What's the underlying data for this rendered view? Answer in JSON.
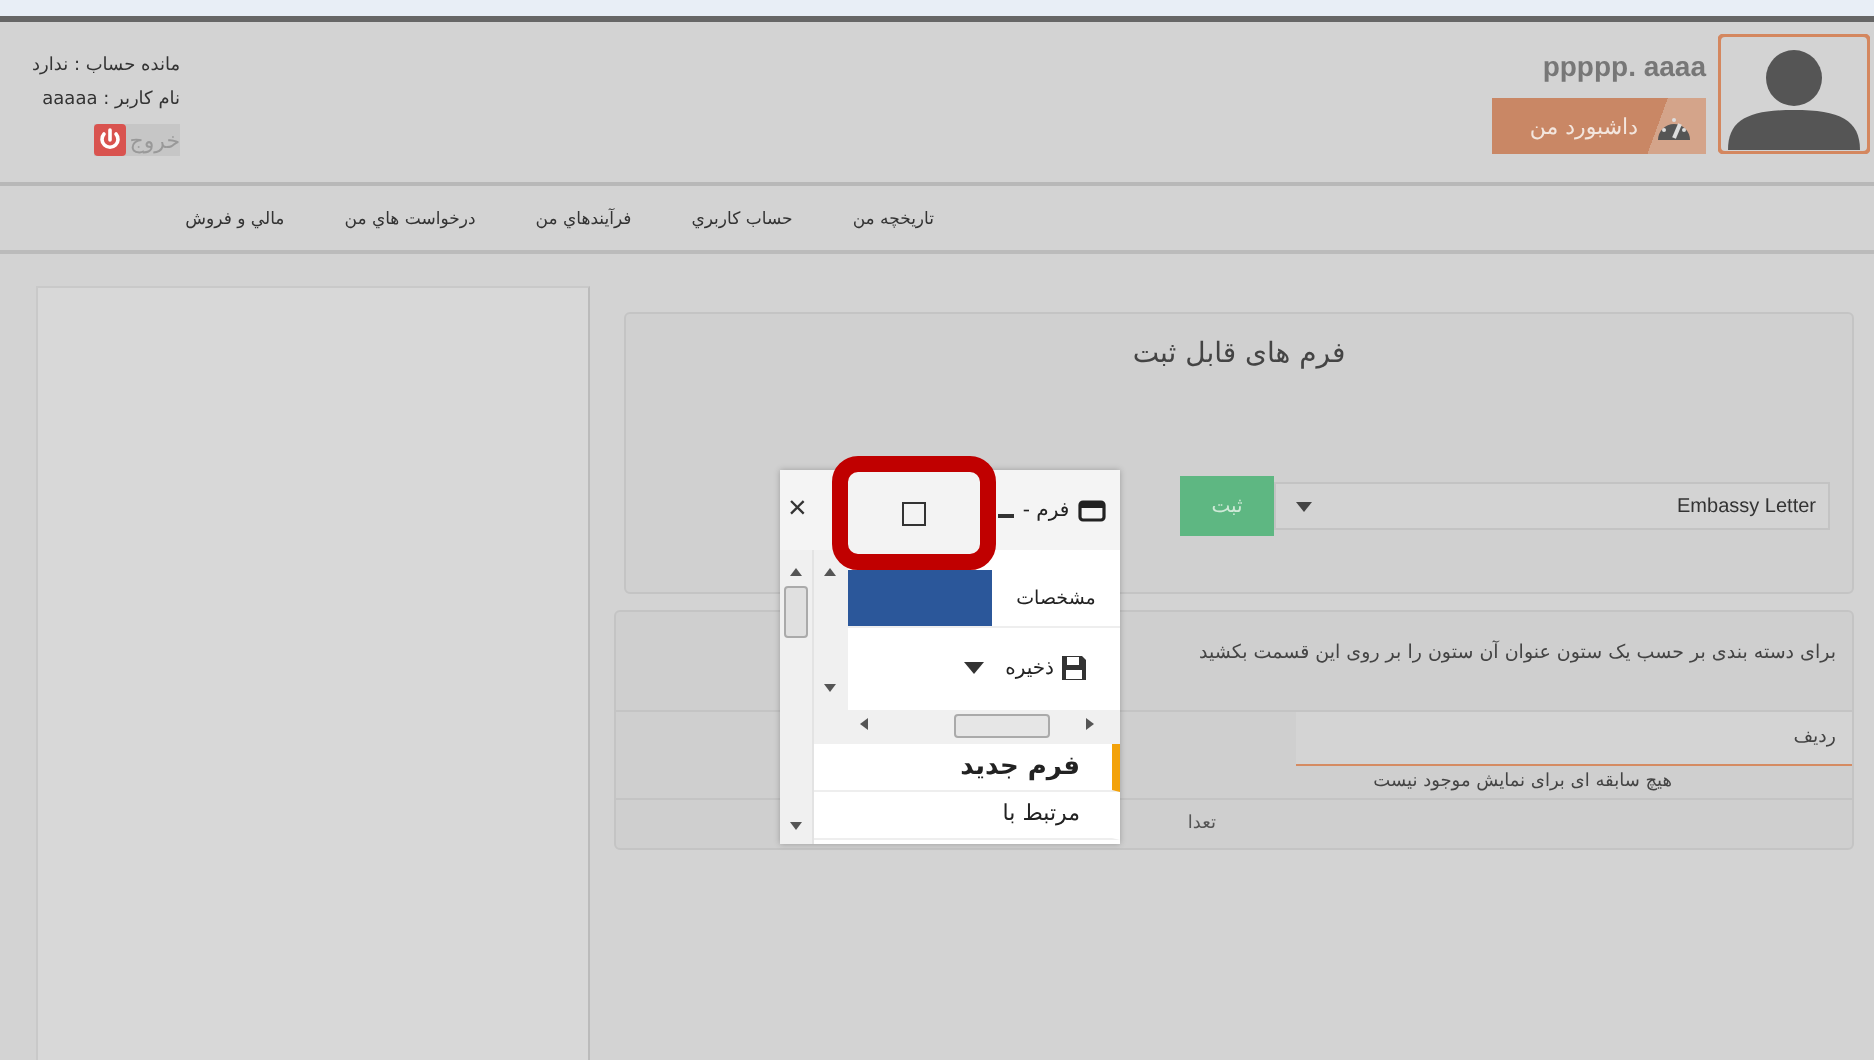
{
  "account": {
    "balance": "مانده حساب : ندارد",
    "username": "نام کاربر : aaaaa",
    "logout": "خروج"
  },
  "user": {
    "name": "ppppp. aaaa",
    "dashboard": "داشبورد من"
  },
  "nav": [
    {
      "label": "تاریخچه من"
    },
    {
      "label": "حساب کاربري"
    },
    {
      "label": "فرآيندهاي من"
    },
    {
      "label": "درخواست هاي من"
    },
    {
      "label": "مالي و فروش"
    }
  ],
  "forms_card": {
    "title": "فرم های قابل ثبت",
    "select_value": "Embassy Letter",
    "submit": "ثبت"
  },
  "grid": {
    "group_hint": "برای دسته بندی بر حسب یک ستون عنوان آن ستون را بر روی این قسمت بکشید",
    "columns": [
      "ردیف"
    ],
    "empty": "هیچ سابقه ای برای نمایش موجود نیست",
    "footer_cell": "تعدا"
  },
  "popup": {
    "close": "×",
    "title": "فرم -",
    "tab": "مشخصات",
    "save": "ذخیره",
    "list": [
      {
        "label": "فرم جدید",
        "selected": true
      },
      {
        "label": "مرتبط با",
        "selected": false
      }
    ]
  }
}
